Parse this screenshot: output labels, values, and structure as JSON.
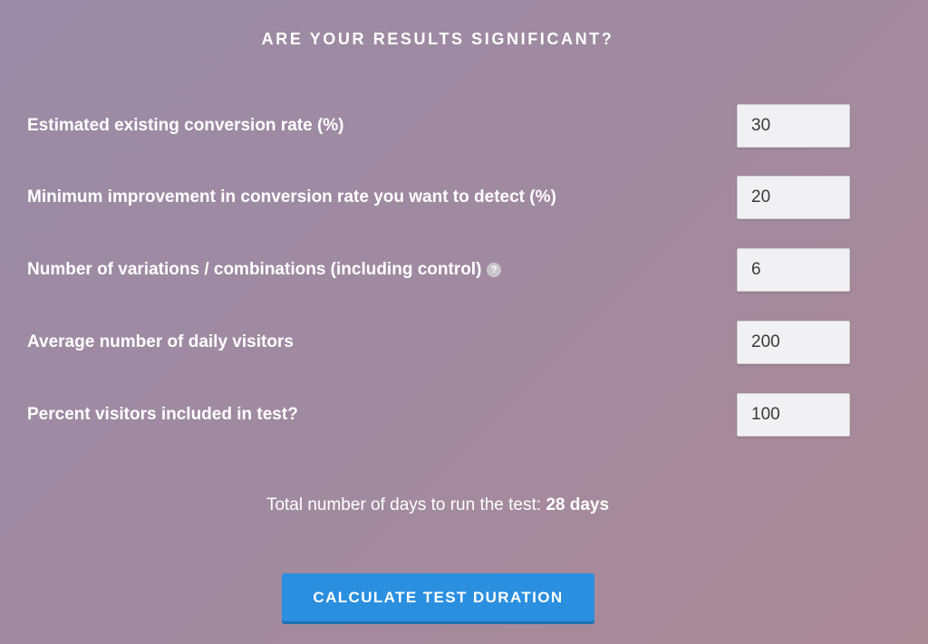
{
  "heading": "ARE YOUR RESULTS SIGNIFICANT?",
  "fields": [
    {
      "label": "Estimated existing conversion rate (%)",
      "value": "30"
    },
    {
      "label": "Minimum improvement in conversion rate you want to detect (%)",
      "value": "20"
    },
    {
      "label": "Number of variations / combinations (including control)",
      "value": "6",
      "help_icon": "?"
    },
    {
      "label": "Average number of daily visitors",
      "value": "200"
    },
    {
      "label": "Percent visitors included in test?",
      "value": "100"
    }
  ],
  "result": {
    "prefix": "Total number of days to run the test:",
    "value": "28 days"
  },
  "button_label": "CALCULATE TEST DURATION",
  "colors": {
    "button": "#2b8fe0",
    "background_start": "#9a8ba6",
    "background_end": "#ab8a96"
  }
}
